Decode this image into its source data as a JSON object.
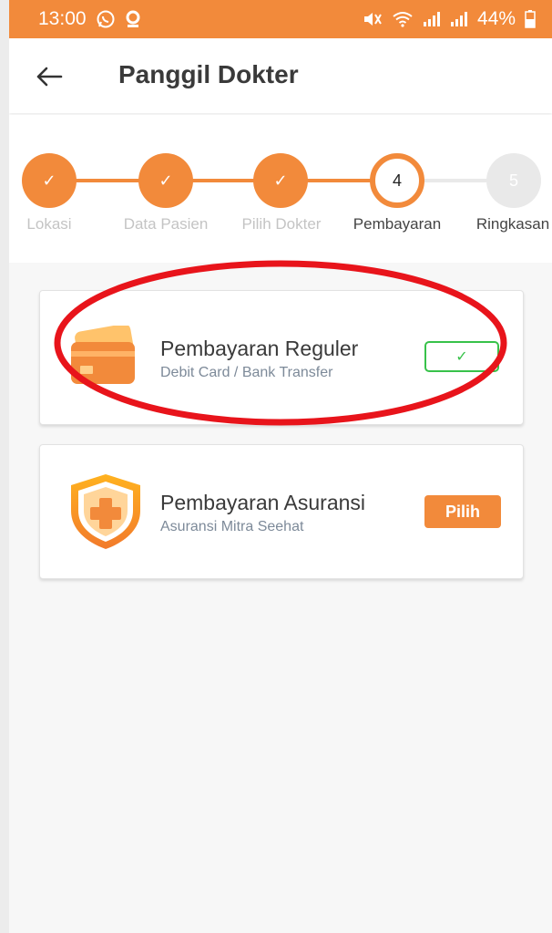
{
  "status_bar": {
    "time": "13:00",
    "battery": "44%"
  },
  "app_bar": {
    "title": "Panggil Dokter",
    "back_icon": "arrow-left-icon"
  },
  "stepper": {
    "steps": [
      {
        "label": "Lokasi",
        "marker": "✓",
        "state": "done"
      },
      {
        "label": "Data Pasien",
        "marker": "✓",
        "state": "done"
      },
      {
        "label": "Pilih Dokter",
        "marker": "✓",
        "state": "done"
      },
      {
        "label": "Pembayaran",
        "marker": "4",
        "state": "active"
      },
      {
        "label": "Ringkasan",
        "marker": "5",
        "state": "todo"
      }
    ]
  },
  "payment_options": [
    {
      "title": "Pembayaran Reguler",
      "subtitle": "Debit Card / Bank Transfer",
      "icon": "credit-card-icon",
      "action": "✓",
      "selected": true
    },
    {
      "title": "Pembayaran Asuransi",
      "subtitle": "Asuransi Mitra Seehat",
      "icon": "insurance-shield-icon",
      "action": "Pilih",
      "selected": false
    }
  ],
  "colors": {
    "accent": "#f28a3b",
    "selected_border": "#38c24a",
    "highlight": "#e8141b"
  }
}
